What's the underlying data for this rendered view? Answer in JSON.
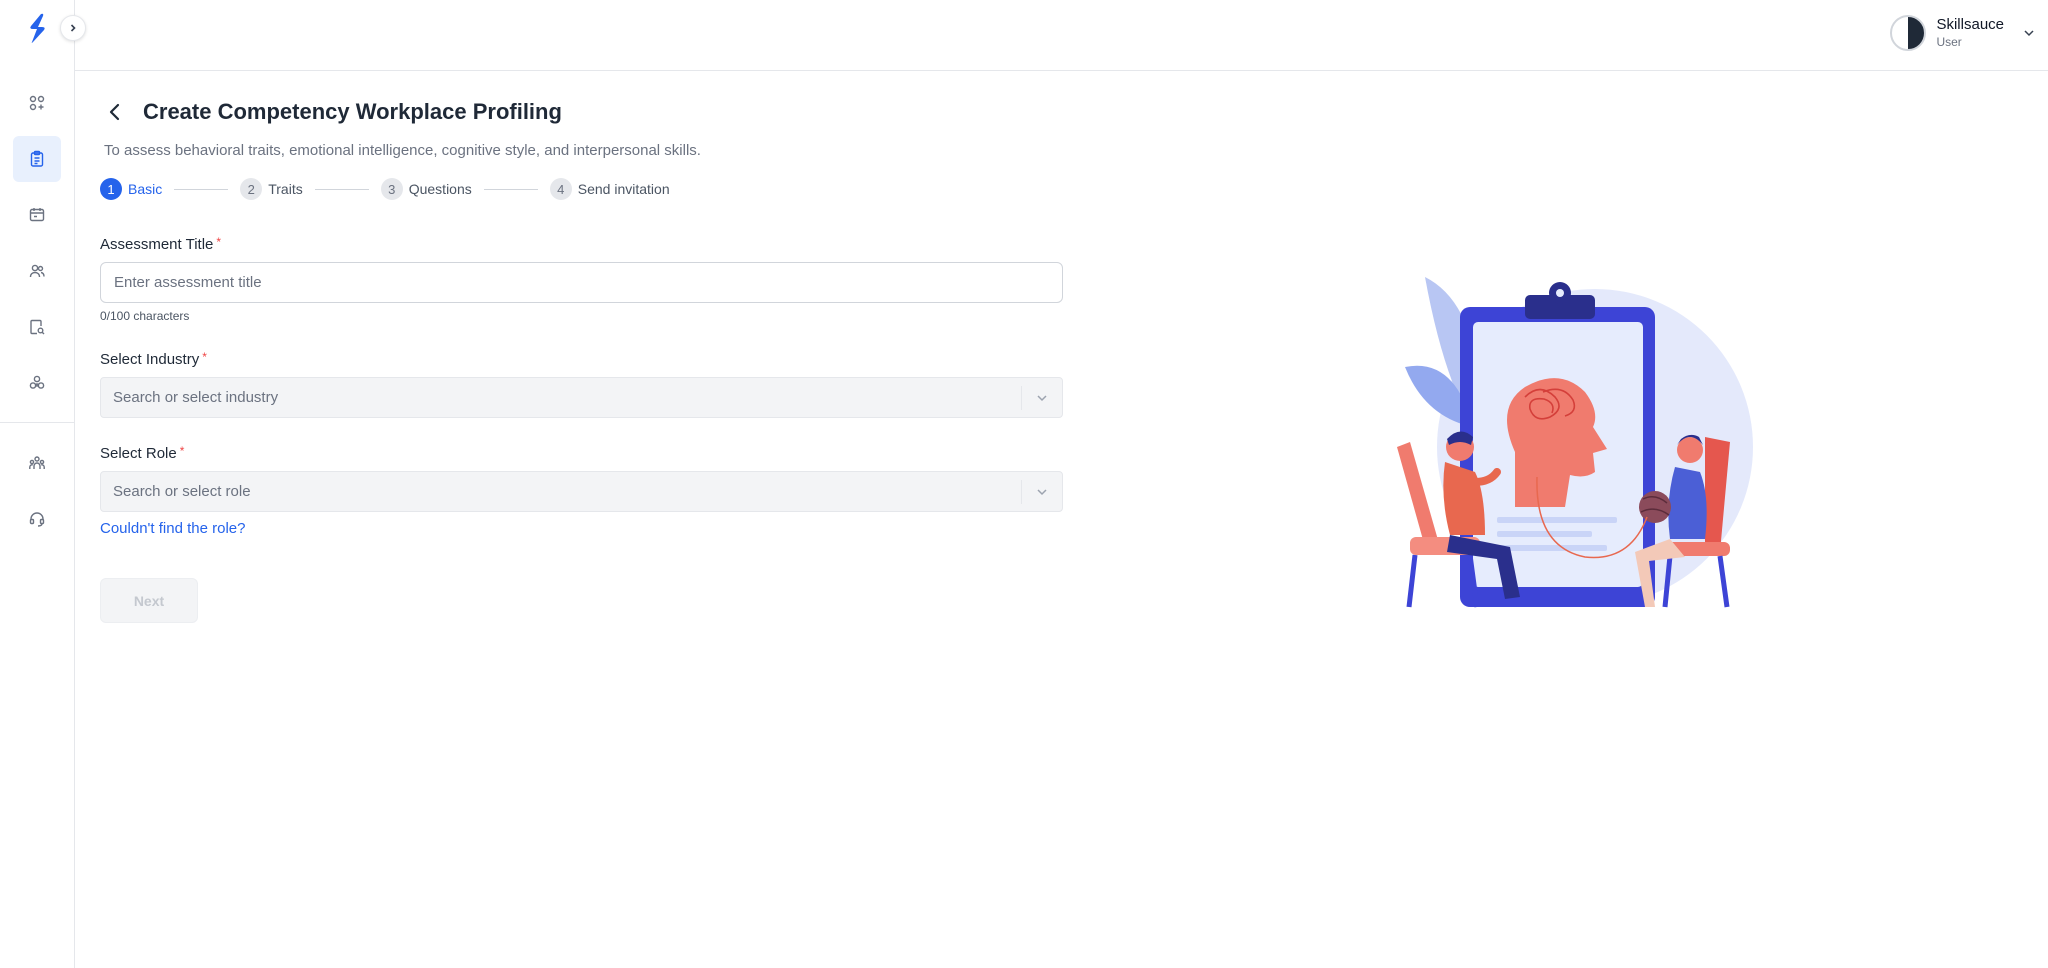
{
  "sidebar": {
    "items": [
      {
        "icon": "dashboard-icon"
      },
      {
        "icon": "clipboard-icon",
        "active": true
      },
      {
        "icon": "calendar-icon"
      },
      {
        "icon": "users-icon"
      },
      {
        "icon": "document-search-icon"
      },
      {
        "icon": "apps-icon"
      },
      {
        "icon": "team-icon"
      },
      {
        "icon": "headset-icon"
      }
    ]
  },
  "user": {
    "name": "Skillsauce",
    "role": "User"
  },
  "page": {
    "title": "Create Competency Workplace Profiling",
    "subtitle": "To assess behavioral traits, emotional intelligence, cognitive style, and interpersonal skills."
  },
  "steps": [
    {
      "num": "1",
      "label": "Basic",
      "active": true
    },
    {
      "num": "2",
      "label": "Traits"
    },
    {
      "num": "3",
      "label": "Questions"
    },
    {
      "num": "4",
      "label": "Send invitation"
    }
  ],
  "form": {
    "title_label": "Assessment Title",
    "title_placeholder": "Enter assessment title",
    "title_value": "",
    "char_count": "0/100 characters",
    "industry_label": "Select Industry",
    "industry_placeholder": "Search or select industry",
    "role_label": "Select Role",
    "role_placeholder": "Search or select role",
    "required_mark": "*",
    "role_link": "Couldn't find the role?",
    "next_label": "Next"
  },
  "colors": {
    "accent": "#2563eb",
    "required": "#ef4444",
    "active_nav_bg": "#e8f0fd"
  }
}
